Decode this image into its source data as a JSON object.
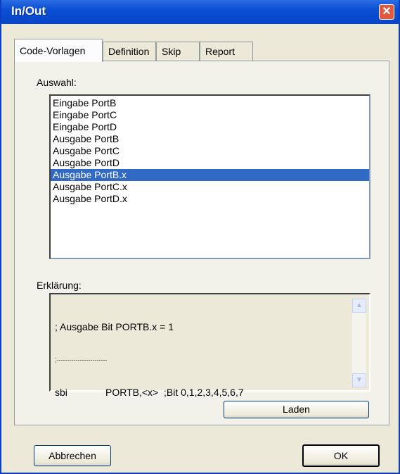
{
  "window": {
    "title": "In/Out",
    "close_glyph": "✕"
  },
  "tabs": [
    {
      "label": "Code-Vorlagen",
      "active": true
    },
    {
      "label": "Definition",
      "active": false
    },
    {
      "label": "Skip",
      "active": false
    },
    {
      "label": "Report",
      "active": false
    }
  ],
  "selection": {
    "label": "Auswahl:",
    "items": [
      "Eingabe PortB",
      "Eingabe PortC",
      "Eingabe PortD",
      "Ausgabe PortB",
      "Ausgabe PortC",
      "Ausgabe PortD",
      "Ausgabe PortB.x",
      "Ausgabe PortC.x",
      "Ausgabe PortD.x"
    ],
    "selected_value": "Ausgabe PortB.x"
  },
  "explanation": {
    "label": "Erklärung:",
    "line1": "; Ausgabe Bit PORTB.x = 1",
    "line2": ";------------------------",
    "line3_mnemonic": "sbi",
    "line3_operands": "PORTB,<x>  ;Bit 0,1,2,3,4,5,6,7",
    "scroll_up_glyph": "▲",
    "scroll_down_glyph": "▼"
  },
  "buttons": {
    "load": "Laden",
    "cancel": "Abbrechen",
    "ok": "OK"
  },
  "colors": {
    "titlebar": "#0b4fd4",
    "selection": "#316ac5",
    "close": "#e2583e"
  }
}
